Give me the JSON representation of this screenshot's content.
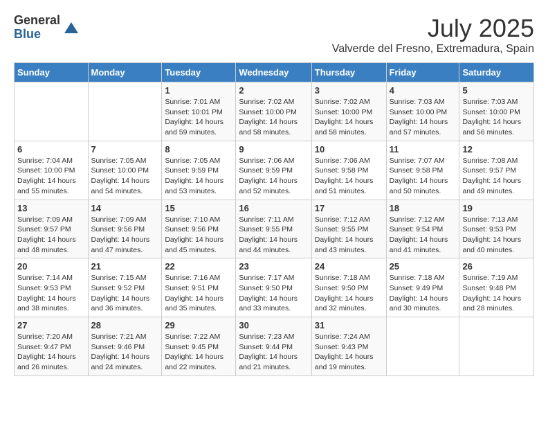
{
  "header": {
    "logo_general": "General",
    "logo_blue": "Blue",
    "month_title": "July 2025",
    "location": "Valverde del Fresno, Extremadura, Spain"
  },
  "days_of_week": [
    "Sunday",
    "Monday",
    "Tuesday",
    "Wednesday",
    "Thursday",
    "Friday",
    "Saturday"
  ],
  "weeks": [
    [
      {
        "day": "",
        "detail": ""
      },
      {
        "day": "",
        "detail": ""
      },
      {
        "day": "1",
        "detail": "Sunrise: 7:01 AM\nSunset: 10:01 PM\nDaylight: 14 hours and 59 minutes."
      },
      {
        "day": "2",
        "detail": "Sunrise: 7:02 AM\nSunset: 10:00 PM\nDaylight: 14 hours and 58 minutes."
      },
      {
        "day": "3",
        "detail": "Sunrise: 7:02 AM\nSunset: 10:00 PM\nDaylight: 14 hours and 58 minutes."
      },
      {
        "day": "4",
        "detail": "Sunrise: 7:03 AM\nSunset: 10:00 PM\nDaylight: 14 hours and 57 minutes."
      },
      {
        "day": "5",
        "detail": "Sunrise: 7:03 AM\nSunset: 10:00 PM\nDaylight: 14 hours and 56 minutes."
      }
    ],
    [
      {
        "day": "6",
        "detail": "Sunrise: 7:04 AM\nSunset: 10:00 PM\nDaylight: 14 hours and 55 minutes."
      },
      {
        "day": "7",
        "detail": "Sunrise: 7:05 AM\nSunset: 10:00 PM\nDaylight: 14 hours and 54 minutes."
      },
      {
        "day": "8",
        "detail": "Sunrise: 7:05 AM\nSunset: 9:59 PM\nDaylight: 14 hours and 53 minutes."
      },
      {
        "day": "9",
        "detail": "Sunrise: 7:06 AM\nSunset: 9:59 PM\nDaylight: 14 hours and 52 minutes."
      },
      {
        "day": "10",
        "detail": "Sunrise: 7:06 AM\nSunset: 9:58 PM\nDaylight: 14 hours and 51 minutes."
      },
      {
        "day": "11",
        "detail": "Sunrise: 7:07 AM\nSunset: 9:58 PM\nDaylight: 14 hours and 50 minutes."
      },
      {
        "day": "12",
        "detail": "Sunrise: 7:08 AM\nSunset: 9:57 PM\nDaylight: 14 hours and 49 minutes."
      }
    ],
    [
      {
        "day": "13",
        "detail": "Sunrise: 7:09 AM\nSunset: 9:57 PM\nDaylight: 14 hours and 48 minutes."
      },
      {
        "day": "14",
        "detail": "Sunrise: 7:09 AM\nSunset: 9:56 PM\nDaylight: 14 hours and 47 minutes."
      },
      {
        "day": "15",
        "detail": "Sunrise: 7:10 AM\nSunset: 9:56 PM\nDaylight: 14 hours and 45 minutes."
      },
      {
        "day": "16",
        "detail": "Sunrise: 7:11 AM\nSunset: 9:55 PM\nDaylight: 14 hours and 44 minutes."
      },
      {
        "day": "17",
        "detail": "Sunrise: 7:12 AM\nSunset: 9:55 PM\nDaylight: 14 hours and 43 minutes."
      },
      {
        "day": "18",
        "detail": "Sunrise: 7:12 AM\nSunset: 9:54 PM\nDaylight: 14 hours and 41 minutes."
      },
      {
        "day": "19",
        "detail": "Sunrise: 7:13 AM\nSunset: 9:53 PM\nDaylight: 14 hours and 40 minutes."
      }
    ],
    [
      {
        "day": "20",
        "detail": "Sunrise: 7:14 AM\nSunset: 9:53 PM\nDaylight: 14 hours and 38 minutes."
      },
      {
        "day": "21",
        "detail": "Sunrise: 7:15 AM\nSunset: 9:52 PM\nDaylight: 14 hours and 36 minutes."
      },
      {
        "day": "22",
        "detail": "Sunrise: 7:16 AM\nSunset: 9:51 PM\nDaylight: 14 hours and 35 minutes."
      },
      {
        "day": "23",
        "detail": "Sunrise: 7:17 AM\nSunset: 9:50 PM\nDaylight: 14 hours and 33 minutes."
      },
      {
        "day": "24",
        "detail": "Sunrise: 7:18 AM\nSunset: 9:50 PM\nDaylight: 14 hours and 32 minutes."
      },
      {
        "day": "25",
        "detail": "Sunrise: 7:18 AM\nSunset: 9:49 PM\nDaylight: 14 hours and 30 minutes."
      },
      {
        "day": "26",
        "detail": "Sunrise: 7:19 AM\nSunset: 9:48 PM\nDaylight: 14 hours and 28 minutes."
      }
    ],
    [
      {
        "day": "27",
        "detail": "Sunrise: 7:20 AM\nSunset: 9:47 PM\nDaylight: 14 hours and 26 minutes."
      },
      {
        "day": "28",
        "detail": "Sunrise: 7:21 AM\nSunset: 9:46 PM\nDaylight: 14 hours and 24 minutes."
      },
      {
        "day": "29",
        "detail": "Sunrise: 7:22 AM\nSunset: 9:45 PM\nDaylight: 14 hours and 22 minutes."
      },
      {
        "day": "30",
        "detail": "Sunrise: 7:23 AM\nSunset: 9:44 PM\nDaylight: 14 hours and 21 minutes."
      },
      {
        "day": "31",
        "detail": "Sunrise: 7:24 AM\nSunset: 9:43 PM\nDaylight: 14 hours and 19 minutes."
      },
      {
        "day": "",
        "detail": ""
      },
      {
        "day": "",
        "detail": ""
      }
    ]
  ]
}
